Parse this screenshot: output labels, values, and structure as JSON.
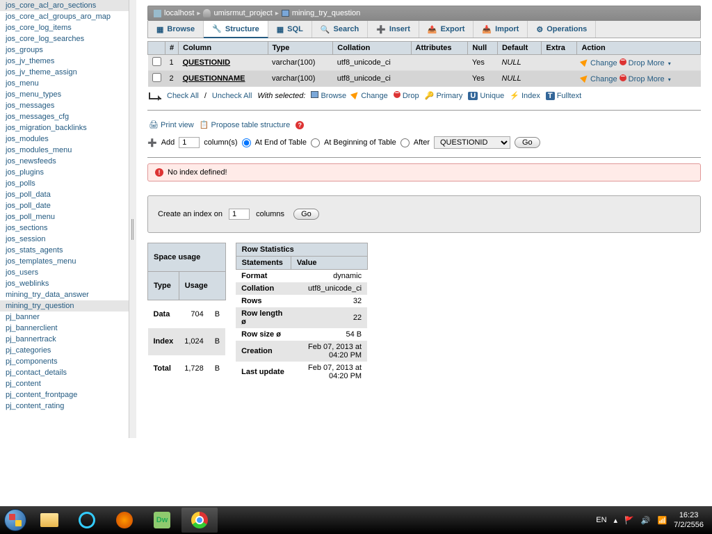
{
  "breadcrumb": {
    "host": "localhost",
    "db": "umisrmut_project",
    "table": "mining_try_question"
  },
  "tabs": [
    {
      "id": "browse",
      "label": "Browse"
    },
    {
      "id": "structure",
      "label": "Structure"
    },
    {
      "id": "sql",
      "label": "SQL"
    },
    {
      "id": "search",
      "label": "Search"
    },
    {
      "id": "insert",
      "label": "Insert"
    },
    {
      "id": "export",
      "label": "Export"
    },
    {
      "id": "import",
      "label": "Import"
    },
    {
      "id": "operations",
      "label": "Operations"
    }
  ],
  "activeTab": "structure",
  "columns_header": {
    "num": "#",
    "col": "Column",
    "type": "Type",
    "coll": "Collation",
    "attr": "Attributes",
    "null": "Null",
    "def": "Default",
    "extra": "Extra",
    "action": "Action"
  },
  "columns": [
    {
      "n": "1",
      "name": "QUESTIONID",
      "type": "varchar(100)",
      "coll": "utf8_unicode_ci",
      "attr": "",
      "null": "Yes",
      "def": "NULL",
      "extra": ""
    },
    {
      "n": "2",
      "name": "QUESTIONNAME",
      "type": "varchar(100)",
      "coll": "utf8_unicode_ci",
      "attr": "",
      "null": "Yes",
      "def": "NULL",
      "extra": ""
    }
  ],
  "row_actions": {
    "change": "Change",
    "drop": "Drop",
    "more": "More"
  },
  "bulk": {
    "checkall": "Check All",
    "uncheck": "Uncheck All",
    "with": "With selected:",
    "browse": "Browse",
    "change": "Change",
    "drop": "Drop",
    "primary": "Primary",
    "unique": "Unique",
    "index": "Index",
    "fulltext": "Fulltext"
  },
  "tools": {
    "printview": "Print view",
    "propose": "Propose table structure"
  },
  "addrow": {
    "add": "Add",
    "val": "1",
    "cols": "column(s)",
    "end": "At End of Table",
    "begin": "At Beginning of Table",
    "after": "After",
    "aftercol": "QUESTIONID",
    "go": "Go"
  },
  "warning": "No index defined!",
  "index_panel": {
    "txt1": "Create an index on",
    "val": "1",
    "txt2": "columns",
    "go": "Go"
  },
  "space": {
    "caption": "Space usage",
    "h1": "Type",
    "h2": "Usage",
    "rows": [
      {
        "t": "Data",
        "v": "704",
        "u": "B"
      },
      {
        "t": "Index",
        "v": "1,024",
        "u": "B"
      },
      {
        "t": "Total",
        "v": "1,728",
        "u": "B"
      }
    ]
  },
  "rowstats": {
    "caption": "Row Statistics",
    "h1": "Statements",
    "h2": "Value",
    "rows": [
      {
        "s": "Format",
        "v": "dynamic"
      },
      {
        "s": "Collation",
        "v": "utf8_unicode_ci"
      },
      {
        "s": "Rows",
        "v": "32"
      },
      {
        "s": "Row length ø",
        "v": "22"
      },
      {
        "s": "Row size ø",
        "v": "54 B"
      },
      {
        "s": "Creation",
        "v": "Feb 07, 2013 at 04:20 PM"
      },
      {
        "s": "Last update",
        "v": "Feb 07, 2013 at 04:20 PM"
      }
    ]
  },
  "sidebar": [
    "jos_core_acl_aro_sections",
    "jos_core_acl_groups_aro_map",
    "jos_core_log_items",
    "jos_core_log_searches",
    "jos_groups",
    "jos_jv_themes",
    "jos_jv_theme_assign",
    "jos_menu",
    "jos_menu_types",
    "jos_messages",
    "jos_messages_cfg",
    "jos_migration_backlinks",
    "jos_modules",
    "jos_modules_menu",
    "jos_newsfeeds",
    "jos_plugins",
    "jos_polls",
    "jos_poll_data",
    "jos_poll_date",
    "jos_poll_menu",
    "jos_sections",
    "jos_session",
    "jos_stats_agents",
    "jos_templates_menu",
    "jos_users",
    "jos_weblinks",
    "mining_try_data_answer",
    "mining_try_question",
    "pj_banner",
    "pj_bannerclient",
    "pj_bannertrack",
    "pj_categories",
    "pj_components",
    "pj_contact_details",
    "pj_content",
    "pj_content_frontpage",
    "pj_content_rating"
  ],
  "sidebar_active": "mining_try_question",
  "tray": {
    "lang": "EN",
    "time": "16:23",
    "date": "7/2/2556"
  }
}
